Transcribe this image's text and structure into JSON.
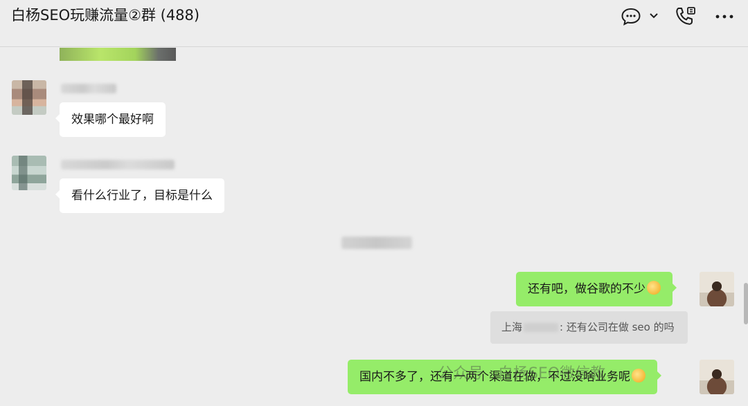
{
  "header": {
    "title": "白杨SEO玩赚流量②群 (488)",
    "icons": [
      "chat-bubble-icon",
      "chevron-down-icon",
      "voice-call-icon",
      "more-icon"
    ]
  },
  "messages": [
    {
      "side": "left",
      "text": "效果哪个最好啊"
    },
    {
      "side": "left",
      "text": "看什么行业了，目标是什么"
    },
    {
      "side": "right",
      "text": "还有吧，做谷歌的不少"
    },
    {
      "side": "right",
      "text": "国内不多了，还有一两个渠道在做，不过没啥业务呢"
    }
  ],
  "quote": {
    "prefix": "上海",
    "text": ": 还有公司在做 seo 的吗"
  },
  "watermark": "公众号 · 白杨SEO微信教",
  "colors": {
    "background": "#ededed",
    "bubble_self": "#95ec69",
    "bubble_other": "#ffffff"
  }
}
